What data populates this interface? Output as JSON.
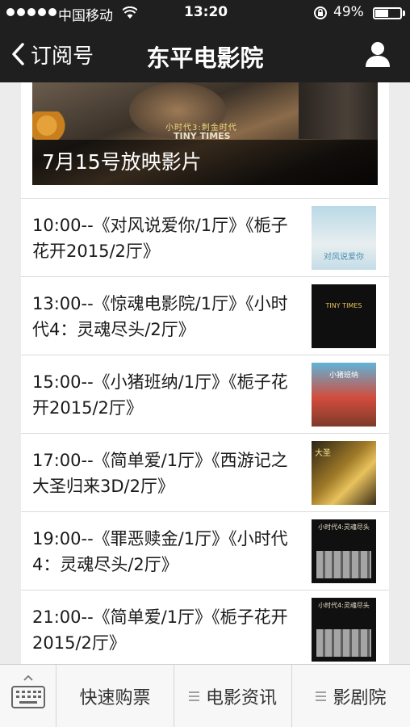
{
  "status_bar": {
    "carrier": "中国移动",
    "time": "13:20",
    "battery_percent_text": "49%",
    "battery_level": 0.49
  },
  "nav": {
    "back_label": "订阅号",
    "title": "东平电影院"
  },
  "banner": {
    "caption": "7月15号放映影片",
    "poster_line1": "小时代3:刺金时代",
    "poster_line2": "TINY TIMES"
  },
  "schedule": [
    {
      "text": "10:00--《对风说爱你/1厅》《栀子花开2015/2厅》",
      "thumb_text": "对风说爱你"
    },
    {
      "text": "13:00--《惊魂电影院/1厅》《小时代4：灵魂尽头/2厅》",
      "thumb_text": "TINY TIMES"
    },
    {
      "text": "15:00--《小猪班纳/1厅》《栀子花开2015/2厅》",
      "thumb_text": "小猪班纳"
    },
    {
      "text": "17:00--《简单爱/1厅》《西游记之大圣归来3D/2厅》",
      "thumb_text": "大圣"
    },
    {
      "text": "19:00--《罪恶赎金/1厅》《小时代4：灵魂尽头/2厅》",
      "thumb_text": "小时代4:灵魂尽头"
    },
    {
      "text": "21:00--《简单爱/1厅》《栀子花开2015/2厅》",
      "thumb_text": "小时代4:灵魂尽头"
    }
  ],
  "tabs": {
    "tab1": "快速购票",
    "tab2": "电影资讯",
    "tab3": "影剧院"
  }
}
